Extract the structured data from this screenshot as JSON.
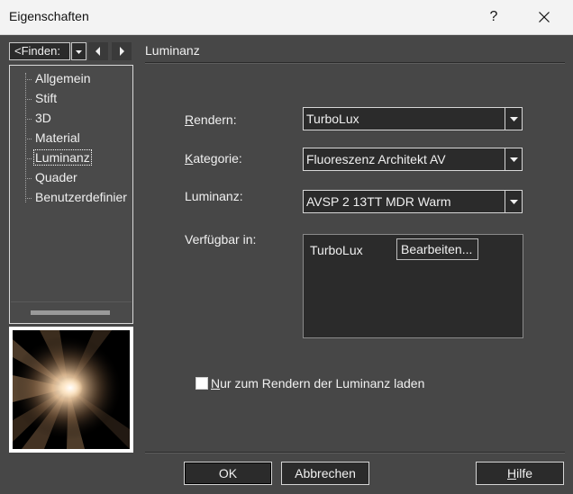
{
  "window": {
    "title": "Eigenschaften",
    "help_glyph": "?",
    "close_glyph": "✕"
  },
  "nav": {
    "find_value": "<Finden:",
    "items": [
      {
        "label": "Allgemein"
      },
      {
        "label": "Stift"
      },
      {
        "label": "3D"
      },
      {
        "label": "Material"
      },
      {
        "label": "Luminanz",
        "selected": true
      },
      {
        "label": "Quader"
      },
      {
        "label": "Benutzerdefinier"
      }
    ]
  },
  "panel": {
    "section_title": "Luminanz",
    "rendern": {
      "label_key": "R",
      "label_rest": "endern:",
      "value": "TurboLux"
    },
    "kategorie": {
      "label_key": "K",
      "label_rest": "ategorie:",
      "value": "Fluoreszenz Architekt AV"
    },
    "luminanz": {
      "label": "Luminanz:",
      "value": "AVSP 2 13TT MDR Warm"
    },
    "available": {
      "label": "Verfügbar in:",
      "renderer": "TurboLux",
      "edit_button": "Bearbeiten..."
    },
    "checkbox": {
      "label_key": "N",
      "label_rest": "ur zum Rendern der Luminanz laden",
      "checked": false
    }
  },
  "buttons": {
    "ok": "OK",
    "cancel": "Abbrechen",
    "help_key": "H",
    "help_rest": "ilfe"
  },
  "colors": {
    "background": "#474747",
    "field": "#2b2b2b",
    "text": "#f0f0f0",
    "titlebar": "#f3f3f3"
  }
}
